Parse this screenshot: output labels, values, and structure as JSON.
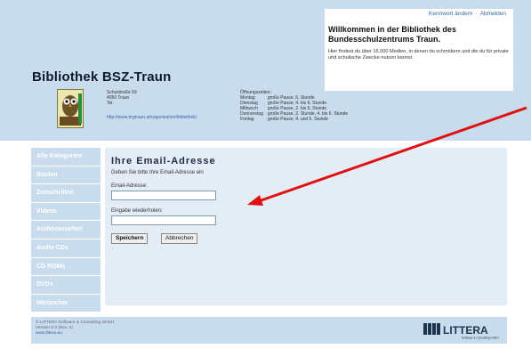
{
  "header": {
    "toplinks": {
      "password": "Kennwort ändern",
      "separator": "·",
      "logout": "Abmelden"
    },
    "welcome": {
      "title": "Willkommen in der Bibliothek des Bundesschulzentrums Traun.",
      "body": "Hier findest du über 16.000 Medien, in denen du schmökern und die du für private und schulische Zwecke nutzen kannst."
    },
    "library_title": "Bibliothek BSZ-Traun",
    "address": {
      "street": "Schulstraße 59",
      "city": "4050 Traun",
      "tel": "Tel.",
      "url": "http://www.brgtraun.at/organisation/bibliothek/"
    },
    "hours": {
      "heading": "Öffnungszeiten:",
      "rows": [
        {
          "day": "Montag",
          "time": "große Pause, 6. Stunde"
        },
        {
          "day": "Dienstag",
          "time": "große Pause, 4. bis 6. Stunde"
        },
        {
          "day": "Mittwoch",
          "time": "große Pause, 2. bis 6. Stunde"
        },
        {
          "day": "Donnerstag",
          "time": "große Pause, 2. Stunde, 4. bis 6. Stunde"
        },
        {
          "day": "Freitag",
          "time": "große Pause, 4. und 5. Stunde"
        }
      ]
    }
  },
  "sidebar": {
    "items": [
      {
        "label": "Alle Kategorien"
      },
      {
        "label": "Bücher"
      },
      {
        "label": "Zeitschriften"
      },
      {
        "label": "Videos"
      },
      {
        "label": "Audiocassetten"
      },
      {
        "label": "Audio CDs"
      },
      {
        "label": "CD ROMs"
      },
      {
        "label": "DVDs"
      },
      {
        "label": "Hörbücher"
      }
    ]
  },
  "main": {
    "title": "Ihre Email-Adresse",
    "description": "Geben Sie bitte Ihre Email-Adresse ein",
    "email_label": "Email-Adresse:",
    "email_value": "",
    "repeat_label": "Eingabe wiederholen:",
    "repeat_value": "",
    "save_label": "Speichern",
    "cancel_label": "Abbrechen"
  },
  "footer": {
    "copyright": "© LITTERA Software & Consulting GmbH",
    "version": "Version 5.0 (Rev. 5)",
    "url": "www.littera.eu",
    "logo_text": "LITTERA",
    "logo_sub": "Software & Consulting GmbH"
  },
  "colors": {
    "header_bg": "#c8dced",
    "panel_bg": "#e4edf6",
    "arrow": "#e01010"
  },
  "icons": {
    "owl": "owl-logo-icon",
    "arrow": "annotation-arrow-icon"
  }
}
